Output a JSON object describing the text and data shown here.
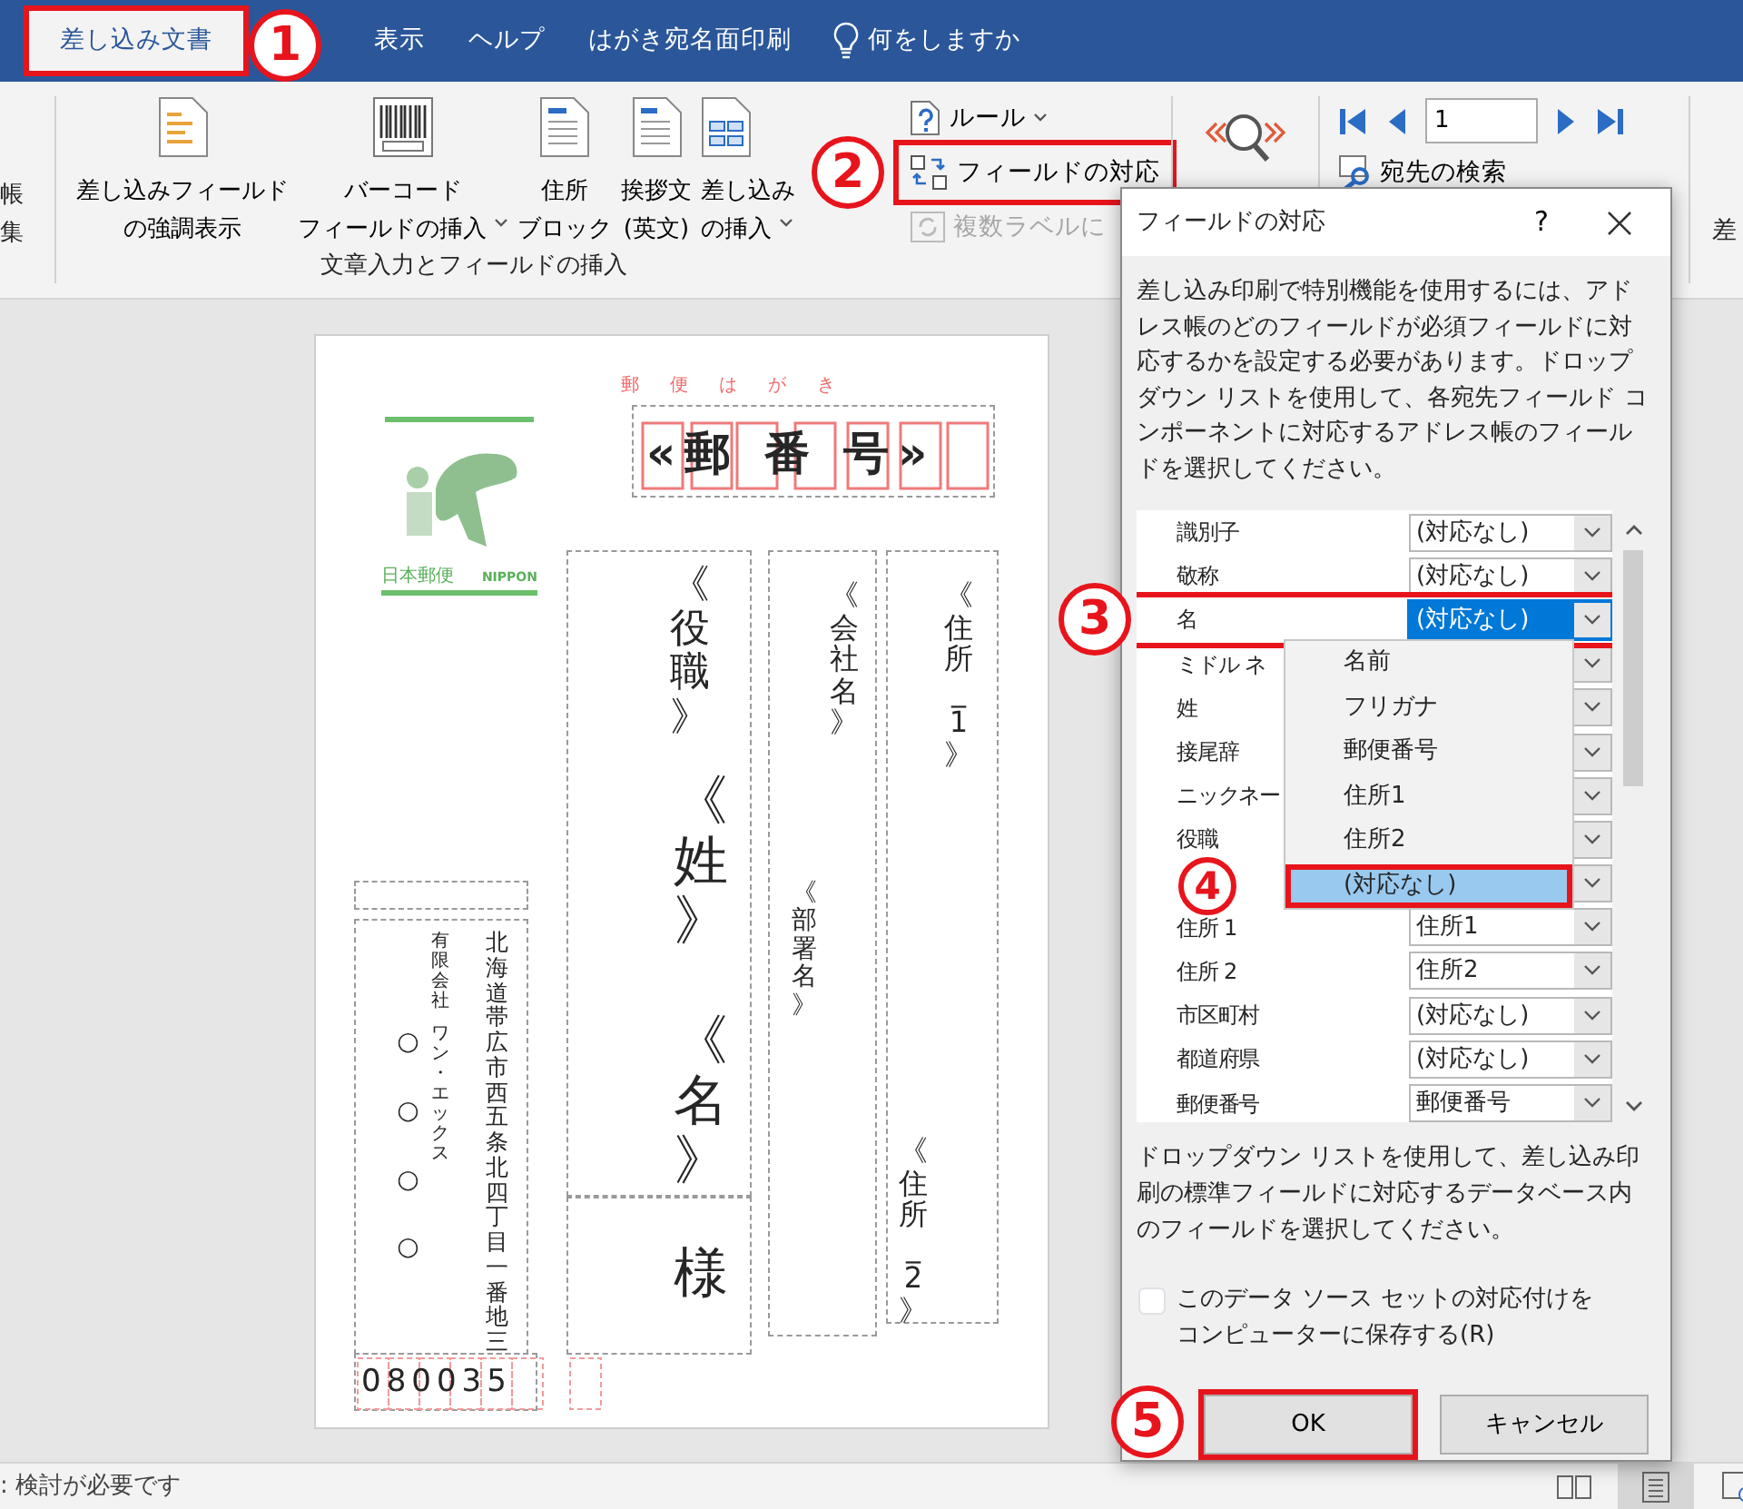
{
  "ribbon_tabs": [
    {
      "label": "差し込み文書",
      "selected": true,
      "highlighted": true
    },
    {
      "label": "表示",
      "selected": false,
      "highlighted": false
    },
    {
      "label": "ヘルプ",
      "selected": false,
      "highlighted": false
    },
    {
      "label": "はがき宛名面印刷",
      "selected": false,
      "highlighted": false
    }
  ],
  "tell_me": {
    "label": "何をしますか"
  },
  "ribbon": {
    "left_cut": [
      "帳",
      "集"
    ],
    "insert_group": {
      "label": "文章入力とフィールドの挿入",
      "buttons": [
        {
          "kind": "highlight",
          "lines": [
            "差し込みフィールド",
            "の強調表示"
          ],
          "dropdown": false
        },
        {
          "kind": "barcode",
          "lines": [
            "バーコード",
            "フィールドの挿入"
          ],
          "dropdown": true
        },
        {
          "kind": "address",
          "lines": [
            "住所",
            "ブロック"
          ],
          "dropdown": false
        },
        {
          "kind": "greeting",
          "lines": [
            "挨拶文",
            "(英文)"
          ],
          "dropdown": false
        },
        {
          "kind": "merge",
          "lines": [
            "差し込み",
            "の挿入"
          ],
          "dropdown": true
        }
      ]
    },
    "small_buttons": [
      {
        "kind": "rules",
        "label": "ルール",
        "dropdown": true,
        "disabled": false,
        "highlighted": false
      },
      {
        "kind": "match",
        "label": "フィールドの対応",
        "dropdown": false,
        "disabled": false,
        "highlighted": true
      },
      {
        "kind": "labels",
        "label": "複数ラベルに",
        "dropdown": false,
        "disabled": true,
        "highlighted": false
      }
    ],
    "record": "1",
    "find_recipient": "宛先の検索",
    "right_cut": "差"
  },
  "postcard": {
    "header": "郵便はがき",
    "postal_code": "«郵 番 号»",
    "stamp": {
      "left_text": "日本郵便",
      "right_text": "NIPPON"
    },
    "fields": [
      {
        "text": "《役職》",
        "kind": "title"
      },
      {
        "text": "《姓》",
        "kind": "name"
      },
      {
        "text": "《名》",
        "kind": "name"
      },
      {
        "text": "様",
        "kind": "name"
      },
      {
        "text": "《会社名》",
        "kind": "company"
      },
      {
        "text": "《部署名》",
        "kind": "department"
      },
      {
        "text": "《住所_1》",
        "kind": "address"
      },
      {
        "text": "《住所_2》",
        "kind": "address"
      }
    ],
    "sender": {
      "address": "北海道帯広市西五条北四丁目一番地三",
      "company_type": "有限会社",
      "company_name": "ワン・エックス",
      "name": "○○ ○○",
      "postal_code": "080035"
    }
  },
  "dialog": {
    "title": "フィールドの対応",
    "help": "?",
    "description": "差し込み印刷で特別機能を使用するには、アドレス帳のどのフィールドが必須フィールドに対応するかを設定する必要があります。ドロップダウン リストを使用して、各宛先フィールド コンポーネントに対応するアドレス帳のフィールドを選択してください。",
    "fields": [
      {
        "kind": "field",
        "label": "識別子",
        "value": "(対応なし)",
        "selected": false,
        "highlighted": false
      },
      {
        "kind": "field",
        "label": "敬称",
        "value": "(対応なし)",
        "selected": false,
        "highlighted": false
      },
      {
        "kind": "field",
        "label": "名",
        "value": "(対応なし)",
        "selected": true,
        "highlighted": true
      },
      {
        "kind": "field",
        "label": "ミドル ネ",
        "selected": false,
        "highlighted": false
      },
      {
        "kind": "field",
        "label": "姓",
        "selected": false,
        "highlighted": false
      },
      {
        "kind": "field",
        "label": "接尾辞",
        "selected": false,
        "highlighted": false
      },
      {
        "kind": "field",
        "label": "ニックネー",
        "selected": false,
        "highlighted": false
      },
      {
        "kind": "field",
        "label": "役職",
        "selected": false,
        "highlighted": false
      },
      {
        "kind": "covered",
        "selected": false,
        "highlighted": false
      },
      {
        "kind": "field",
        "label": "住所 1",
        "value": "住所1",
        "selected": false,
        "highlighted": false
      },
      {
        "kind": "field",
        "label": "住所 2",
        "value": "住所2",
        "selected": false,
        "highlighted": false
      },
      {
        "kind": "field",
        "label": "市区町村",
        "value": "(対応なし)",
        "selected": false,
        "highlighted": false
      },
      {
        "kind": "field",
        "label": "都道府県",
        "value": "(対応なし)",
        "selected": false,
        "highlighted": false
      },
      {
        "kind": "field",
        "label": "郵便番号",
        "value": "郵便番号",
        "selected": false,
        "highlighted": false
      }
    ],
    "dropdown": {
      "options": [
        {
          "label": "名前",
          "selected": false,
          "highlighted": false
        },
        {
          "label": "フリガナ",
          "selected": false,
          "highlighted": false
        },
        {
          "label": "郵便番号",
          "selected": false,
          "highlighted": false
        },
        {
          "label": "住所1",
          "selected": false,
          "highlighted": false
        },
        {
          "label": "住所2",
          "selected": false,
          "highlighted": false
        },
        {
          "label": "(対応なし)",
          "selected": true,
          "highlighted": true
        }
      ]
    },
    "note": "ドロップダウン リストを使用して、差し込み印刷の標準フィールドに対応するデータベース内のフィールドを選択してください。",
    "save_checkbox": {
      "label": "このデータ ソース セットの対応付けをコンピューターに保存する(R)",
      "checked": false
    },
    "buttons": [
      {
        "label": "OK",
        "highlighted": true
      },
      {
        "label": "キャンセル",
        "highlighted": false
      }
    ]
  },
  "status_bar": {
    "text": ": 検討が必要です"
  },
  "callouts": [
    {
      "number": "1"
    },
    {
      "number": "2"
    },
    {
      "number": "3"
    },
    {
      "number": "4"
    },
    {
      "number": "5"
    }
  ]
}
